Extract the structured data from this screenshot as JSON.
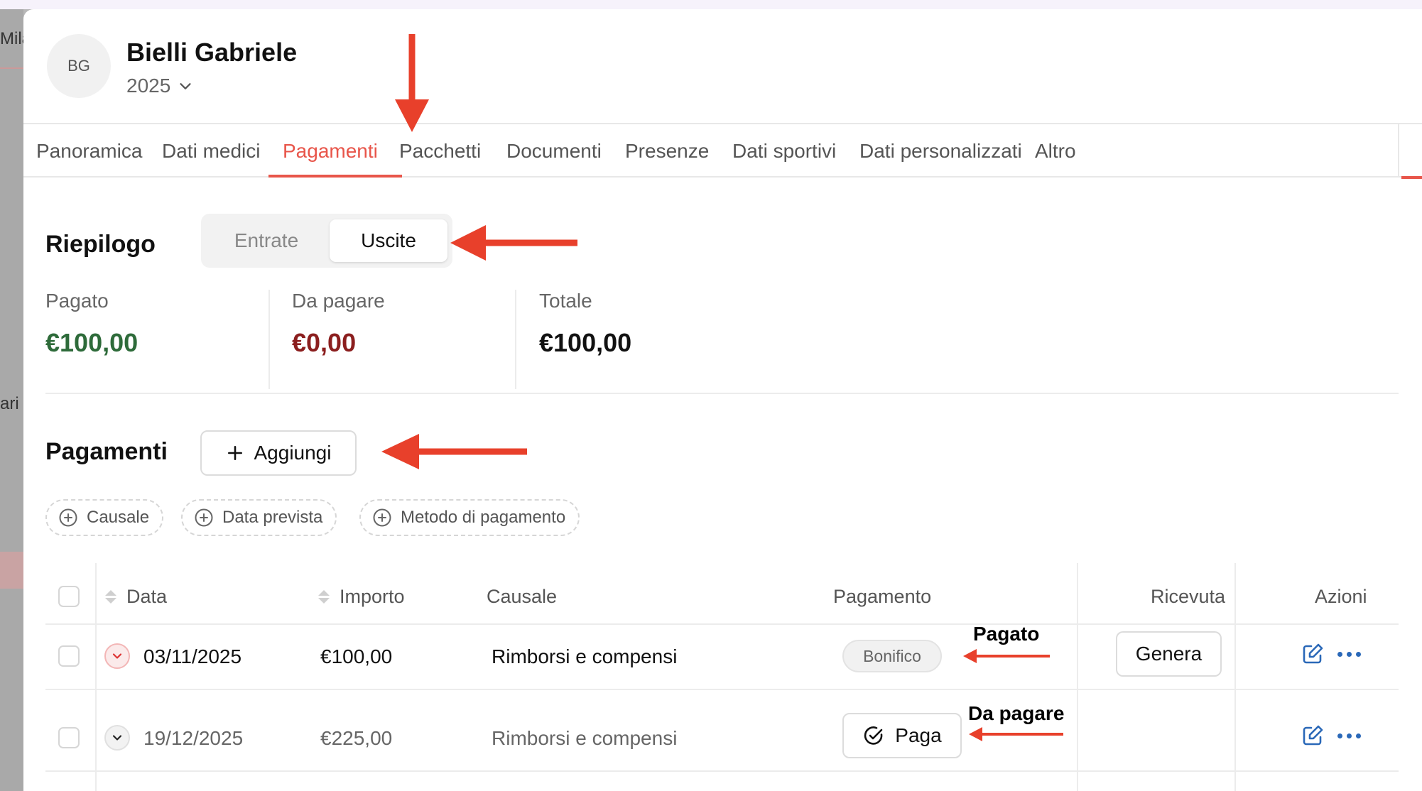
{
  "background": {
    "frag_top": "Mila",
    "frag_mid": "ari"
  },
  "header": {
    "initials": "BG",
    "name": "Bielli Gabriele",
    "year": "2025"
  },
  "tabs": [
    {
      "label": "Panoramica"
    },
    {
      "label": "Dati medici"
    },
    {
      "label": "Pagamenti"
    },
    {
      "label": "Pacchetti"
    },
    {
      "label": "Documenti"
    },
    {
      "label": "Presenze"
    },
    {
      "label": "Dati sportivi"
    },
    {
      "label": "Dati personalizzati"
    },
    {
      "label": "Altro"
    }
  ],
  "summary": {
    "title": "Riepilogo",
    "toggle": [
      "Entrate",
      "Uscite"
    ],
    "selected": "Uscite",
    "stats": [
      {
        "label": "Pagato",
        "value": "€100,00"
      },
      {
        "label": "Da pagare",
        "value": "€0,00"
      },
      {
        "label": "Totale",
        "value": "€100,00"
      }
    ]
  },
  "payments": {
    "title": "Pagamenti",
    "add_label": "Aggiungi",
    "filters": [
      "Causale",
      "Data prevista",
      "Metodo di pagamento"
    ],
    "columns": [
      "Data",
      "Importo",
      "Causale",
      "Pagamento",
      "Ricevuta",
      "Azioni"
    ],
    "rows": [
      {
        "date": "03/11/2025",
        "amount": "€100,00",
        "reason": "Rimborsi e compensi",
        "payment": "Bonifico",
        "receipt": "Genera",
        "status": "paid"
      },
      {
        "date": "19/12/2025",
        "amount": "€225,00",
        "reason": "Rimborsi e compensi",
        "payment": "Paga",
        "receipt": "",
        "status": "unpaid"
      }
    ]
  },
  "annotations": {
    "paid": "Pagato",
    "unpaid": "Da pagare"
  },
  "colors": {
    "accent": "#e8554a",
    "paid_green": "#2e6b3a",
    "due_red": "#8b1e1e",
    "action_blue": "#2a68b8",
    "arrow_red": "#e8402b"
  }
}
